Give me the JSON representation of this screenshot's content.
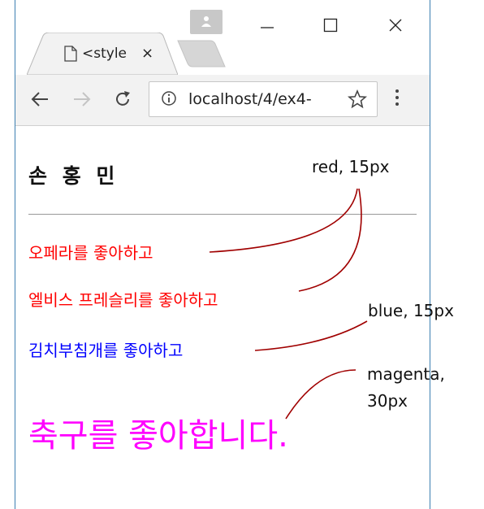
{
  "browser": {
    "tab_title": "<style",
    "tab_close": "×",
    "url": "localhost/4/ex4-",
    "window_buttons": [
      "minimize",
      "maximize",
      "close"
    ],
    "icons": [
      "profile-icon",
      "page-icon",
      "back-icon",
      "forward-icon",
      "reload-icon",
      "info-icon",
      "star-icon",
      "menu-icon"
    ]
  },
  "page": {
    "heading": "손 홍 민",
    "lines": [
      {
        "text": "오페라를 좋아하고",
        "color": "#ff0000"
      },
      {
        "text": "엘비스 프레슬리를 좋아하고",
        "color": "#ff0000"
      },
      {
        "text": "김치부침개를 좋아하고",
        "color": "#0000ff"
      },
      {
        "text": "축구를 좋아합니다.",
        "color": "#ff00ff"
      }
    ]
  },
  "annotations": {
    "red": "red, 15px",
    "blue": "blue, 15px",
    "magenta_1": "magenta,",
    "magenta_2": "30px",
    "arrow_color": "#a00000"
  }
}
